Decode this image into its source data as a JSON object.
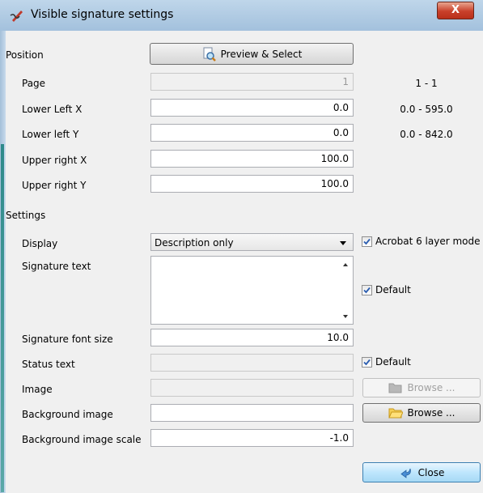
{
  "window": {
    "title": "Visible signature settings",
    "close_glyph": "X"
  },
  "position": {
    "section_label": "Position",
    "preview_button": "Preview & Select",
    "page_label": "Page",
    "page_value": "1",
    "page_range": "1 - 1",
    "llx_label": "Lower Left X",
    "llx_value": "0.0",
    "llx_range": "0.0 - 595.0",
    "lly_label": "Lower left Y",
    "lly_value": "0.0",
    "lly_range": "0.0 - 842.0",
    "urx_label": "Upper right X",
    "urx_value": "100.0",
    "ury_label": "Upper right Y",
    "ury_value": "100.0"
  },
  "settings": {
    "section_label": "Settings",
    "display_label": "Display",
    "display_value": "Description only",
    "acrobat_label": "Acrobat 6 layer mode",
    "signature_text_label": "Signature text",
    "signature_text_value": "",
    "default_label_1": "Default",
    "font_size_label": "Signature font size",
    "font_size_value": "10.0",
    "status_text_label": "Status text",
    "status_text_value": "",
    "default_label_2": "Default",
    "image_label": "Image",
    "image_value": "",
    "browse_disabled_label": "Browse ...",
    "bg_image_label": "Background image",
    "bg_image_value": "",
    "browse_label": "Browse ...",
    "bg_scale_label": "Background image scale",
    "bg_scale_value": "-1.0",
    "close_button": "Close"
  },
  "colors": {
    "frame": "#a9c4de",
    "client": "#f0f0f0",
    "close_red": "#c9402a"
  },
  "icons": {
    "title": "signature-pen-icon",
    "preview": "magnifier-document-icon",
    "browse": "folder-icon",
    "close": "close-arrow-icon",
    "checkbox": "checkmark-icon"
  }
}
